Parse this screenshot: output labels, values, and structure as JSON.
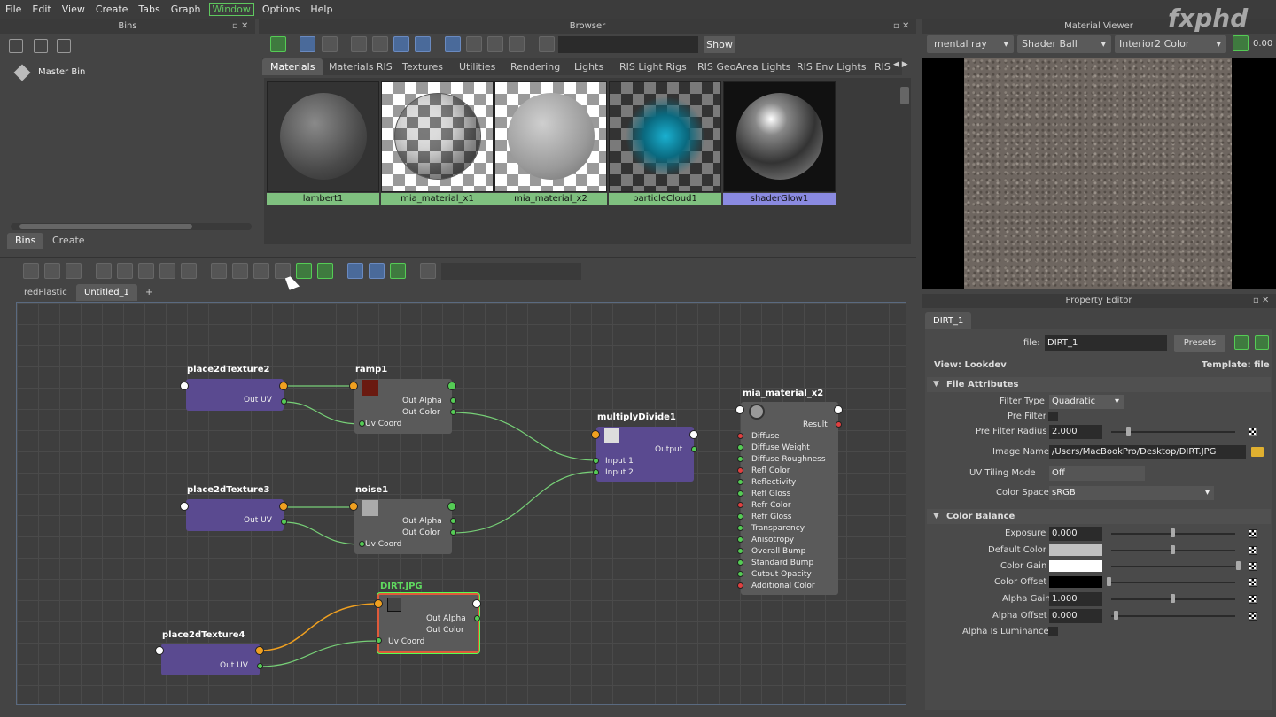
{
  "menu": [
    "File",
    "Edit",
    "View",
    "Create",
    "Tabs",
    "Graph",
    "Window",
    "Options",
    "Help"
  ],
  "bins": {
    "title": "Bins",
    "master": "Master Bin",
    "tabs": [
      "Bins",
      "Create"
    ]
  },
  "browser": {
    "title": "Browser",
    "show": "Show",
    "tabs": [
      "Materials",
      "Materials RIS",
      "Textures",
      "Utilities",
      "Rendering",
      "Lights",
      "RIS Light Rigs",
      "RIS GeoArea Lights",
      "RIS Env Lights",
      "RIS"
    ],
    "swatches": [
      "lambert1",
      "mia_material_x1",
      "mia_material_x2",
      "particleCloud1",
      "shaderGlow1"
    ]
  },
  "editor_tabs": [
    "redPlastic",
    "Untitled_1",
    "+"
  ],
  "nodes": {
    "p2d2": {
      "name": "place2dTexture2",
      "out": "Out UV"
    },
    "p2d3": {
      "name": "place2dTexture3",
      "out": "Out UV"
    },
    "p2d4": {
      "name": "place2dTexture4",
      "out": "Out UV"
    },
    "ramp": {
      "name": "ramp1",
      "a": "Out Alpha",
      "c": "Out Color",
      "uv": "Uv Coord"
    },
    "noise": {
      "name": "noise1",
      "a": "Out Alpha",
      "c": "Out Color",
      "uv": "Uv Coord"
    },
    "dirt": {
      "name": "DIRT.JPG",
      "a": "Out Alpha",
      "c": "Out Color",
      "uv": "Uv Coord"
    },
    "mult": {
      "name": "multiplyDivide1",
      "out": "Output",
      "in1": "Input 1",
      "in2": "Input 2"
    },
    "mia": {
      "name": "mia_material_x2",
      "result": "Result",
      "attrs": [
        "Diffuse",
        "Diffuse Weight",
        "Diffuse Roughness",
        "Refl Color",
        "Reflectivity",
        "Refl Gloss",
        "Refr Color",
        "Refr Gloss",
        "Transparency",
        "Anisotropy",
        "Overall Bump",
        "Standard Bump",
        "Cutout Opacity",
        "Additional Color"
      ]
    }
  },
  "viewer": {
    "title": "Material Viewer",
    "renderer": "mental ray",
    "shape": "Shader Ball",
    "env": "Interior2 Color",
    "value": "0.00",
    "watermark": "fxphd"
  },
  "pe": {
    "title": "Property Editor",
    "tab": "DIRT_1",
    "file_label": "file:",
    "file_value": "DIRT_1",
    "presets": "Presets",
    "view": "View: Lookdev",
    "template": "Template: file",
    "sec1": "File Attributes",
    "filter_type_l": "Filter Type",
    "filter_type": "Quadratic",
    "pre_filter_l": "Pre Filter",
    "pfr_l": "Pre Filter Radius",
    "pfr": "2.000",
    "img_l": "Image Name",
    "img": "/Users/MacBookPro/Desktop/DIRT.JPG",
    "uvt_l": "UV Tiling Mode",
    "uvt": "Off",
    "cs_l": "Color Space",
    "cs": "sRGB",
    "sec2": "Color Balance",
    "exp_l": "Exposure",
    "exp": "0.000",
    "dc_l": "Default Color",
    "cg_l": "Color Gain",
    "co_l": "Color Offset",
    "ag_l": "Alpha Gain",
    "ag": "1.000",
    "ao_l": "Alpha Offset",
    "ao": "0.000",
    "ail_l": "Alpha Is Luminance"
  }
}
